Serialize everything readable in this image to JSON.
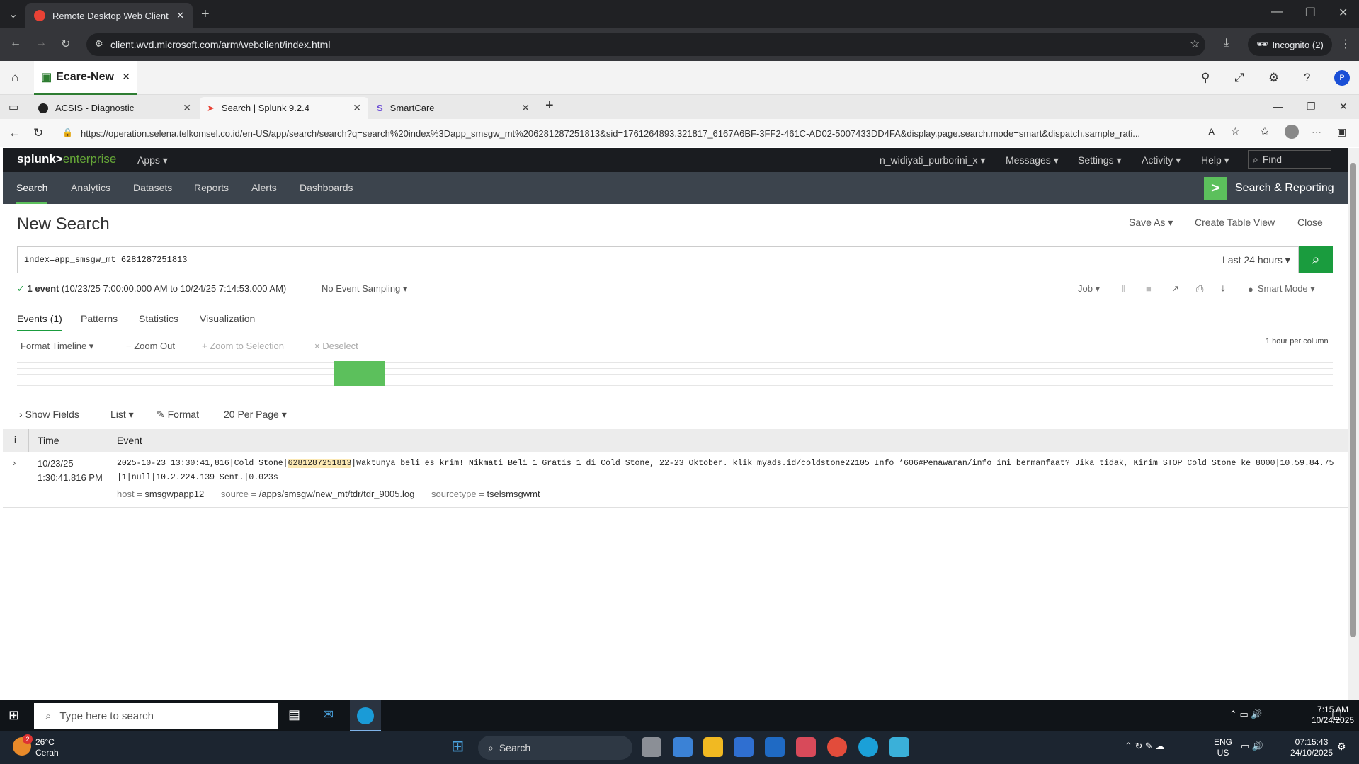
{
  "chrome": {
    "tab_title": "Remote Desktop Web Client",
    "url": "client.wvd.microsoft.com/arm/webclient/index.html",
    "incognito": "Incognito (2)"
  },
  "rd": {
    "tab_title": "Ecare-New",
    "avatar": "P"
  },
  "edge": {
    "tabs": [
      {
        "label": "ACSIS - Diagnostic"
      },
      {
        "label": "Search | Splunk 9.2.4"
      },
      {
        "label": "SmartCare"
      }
    ],
    "url": "https://operation.selena.telkomsel.co.id/en-US/app/search/search?q=search%20index%3Dapp_smsgw_mt%206281287251813&sid=1761264893.321817_6167A6BF-3FF2-461C-AD02-5007433DD4FA&display.page.search.mode=smart&dispatch.sample_rati..."
  },
  "splunk": {
    "logo_main": "splunk>",
    "logo_sub": "enterprise",
    "top_menu": {
      "apps": "Apps ▾",
      "user": "n_widiyati_purborini_x ▾",
      "messages": "Messages ▾",
      "settings": "Settings ▾",
      "activity": "Activity ▾",
      "help": "Help ▾",
      "find": "Find"
    },
    "nav": [
      "Search",
      "Analytics",
      "Datasets",
      "Reports",
      "Alerts",
      "Dashboards"
    ],
    "app_name": "Search & Reporting",
    "page_title": "New Search",
    "save_as": "Save As ▾",
    "create_table": "Create Table View",
    "close": "Close",
    "query": "index=app_smsgw_mt 6281287251813",
    "time_range": "Last 24 hours ▾",
    "status": {
      "count": "1 event",
      "range": "(10/23/25 7:00:00.000 AM to 10/24/25 7:14:53.000 AM)",
      "sampling": "No Event Sampling ▾"
    },
    "job": "Job ▾",
    "mode": "Smart Mode ▾",
    "result_tabs": [
      "Events (1)",
      "Patterns",
      "Statistics",
      "Visualization"
    ],
    "timeline": {
      "format": "Format Timeline ▾",
      "zoom_out": "− Zoom Out",
      "zoom_sel": "+ Zoom to Selection",
      "deselect": "× Deselect",
      "scale": "1 hour per column"
    },
    "options": {
      "show_fields": "Show Fields",
      "list": "List ▾",
      "format": "Format",
      "per_page": "20 Per Page ▾"
    },
    "table_headers": {
      "info": "i",
      "time": "Time",
      "event": "Event"
    },
    "event": {
      "date": "10/23/25",
      "time": "1:30:41.816 PM",
      "text_pre": "2025-10-23 13:30:41,816|Cold Stone|",
      "text_hl": "6281287251813",
      "text_post": "|Waktunya beli es krim! Nikmati Beli 1 Gratis 1 di Cold Stone, 22-23 Oktober. klik myads.id/coldstone22105 Info *606#Penawaran/info ini bermanfaat? Jika tidak, Kirim STOP Cold Stone ke 8000|10.59.84.75|1|null|10.2.224.139|Sent.|0.023s",
      "host_k": "host =",
      "host_v": "smsgwpapp12",
      "source_k": "source =",
      "source_v": "/apps/smsgw/new_mt/tdr/tdr_9005.log",
      "stype_k": "sourcetype =",
      "stype_v": "tselsmsgwmt"
    }
  },
  "taskbar1": {
    "search": "Type here to search",
    "time": "7:15 AM",
    "date": "10/24/2025"
  },
  "taskbar2": {
    "weather_temp": "26°C",
    "weather_desc": "Cerah",
    "badge": "2",
    "search": "Search",
    "lang": "ENG",
    "region": "US",
    "time": "07:15:43",
    "date": "24/10/2025"
  }
}
